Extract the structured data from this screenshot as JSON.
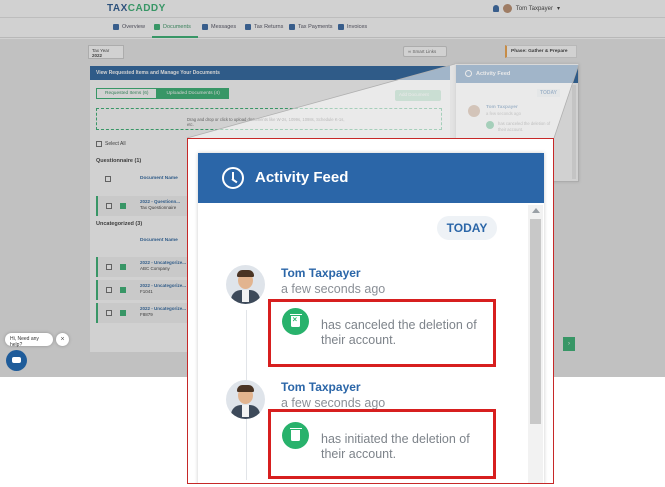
{
  "app": {
    "logo_main": "TAX",
    "logo_accent": "CADDY"
  },
  "user": {
    "name": "Tom Taxpayer"
  },
  "nav": [
    {
      "label": "Overview"
    },
    {
      "label": "Documents",
      "active": true
    },
    {
      "label": "Messages"
    },
    {
      "label": "Tax Returns"
    },
    {
      "label": "Tax Payments"
    },
    {
      "label": "Invoices"
    }
  ],
  "toolbar": {
    "tax_year_label": "Tax Year",
    "tax_year_value": "2022",
    "smart_links_label": "Smart Links",
    "phase_label": "Phase: Gather & Prepare"
  },
  "docs_panel": {
    "header": "View Requested Items and Manage Your Documents",
    "tabs": [
      {
        "label": "Requested Items (6)"
      },
      {
        "label": "Uploaded Documents (4)",
        "active": true
      }
    ],
    "add_button": "Add Document",
    "dropzone_text": "Drag and drop or click to upload documents like W-2s, 1099s, 1098s, Schedule K-1s, etc.",
    "select_all": "Select All",
    "sections": [
      {
        "title": "Questionnaire (1)",
        "column": "Document Name",
        "rows": [
          {
            "name": "2022 - Questionn...",
            "sub": "Tax Questionnaire"
          }
        ]
      },
      {
        "title": "Uncategorized (3)",
        "column": "Document Name",
        "rows": [
          {
            "name": "2022 - Uncategorize...",
            "sub": "ABC Company"
          },
          {
            "name": "2022 - Uncategorize...",
            "sub": "F1041"
          },
          {
            "name": "2022 - Uncategorize...",
            "sub": "F8879"
          }
        ]
      }
    ]
  },
  "activity_feed": {
    "title": "Activity Feed",
    "date_group": "TODAY",
    "entries": [
      {
        "user": "Tom Taxpayer",
        "time": "a few seconds ago",
        "text": "has canceled the deletion of their account.",
        "icon": "trash-cancel-icon",
        "highlighted": true
      },
      {
        "user": "Tom Taxpayer",
        "time": "a few seconds ago",
        "text": "has initiated the deletion of their account.",
        "icon": "trash-icon",
        "highlighted": true
      }
    ]
  },
  "help_widget": {
    "bubble_text": "Hi, Need any help?",
    "close_label": "×"
  },
  "colors": {
    "brand_blue": "#2b66a8",
    "brand_green": "#28b26c",
    "highlight_red": "#d71f1f"
  }
}
